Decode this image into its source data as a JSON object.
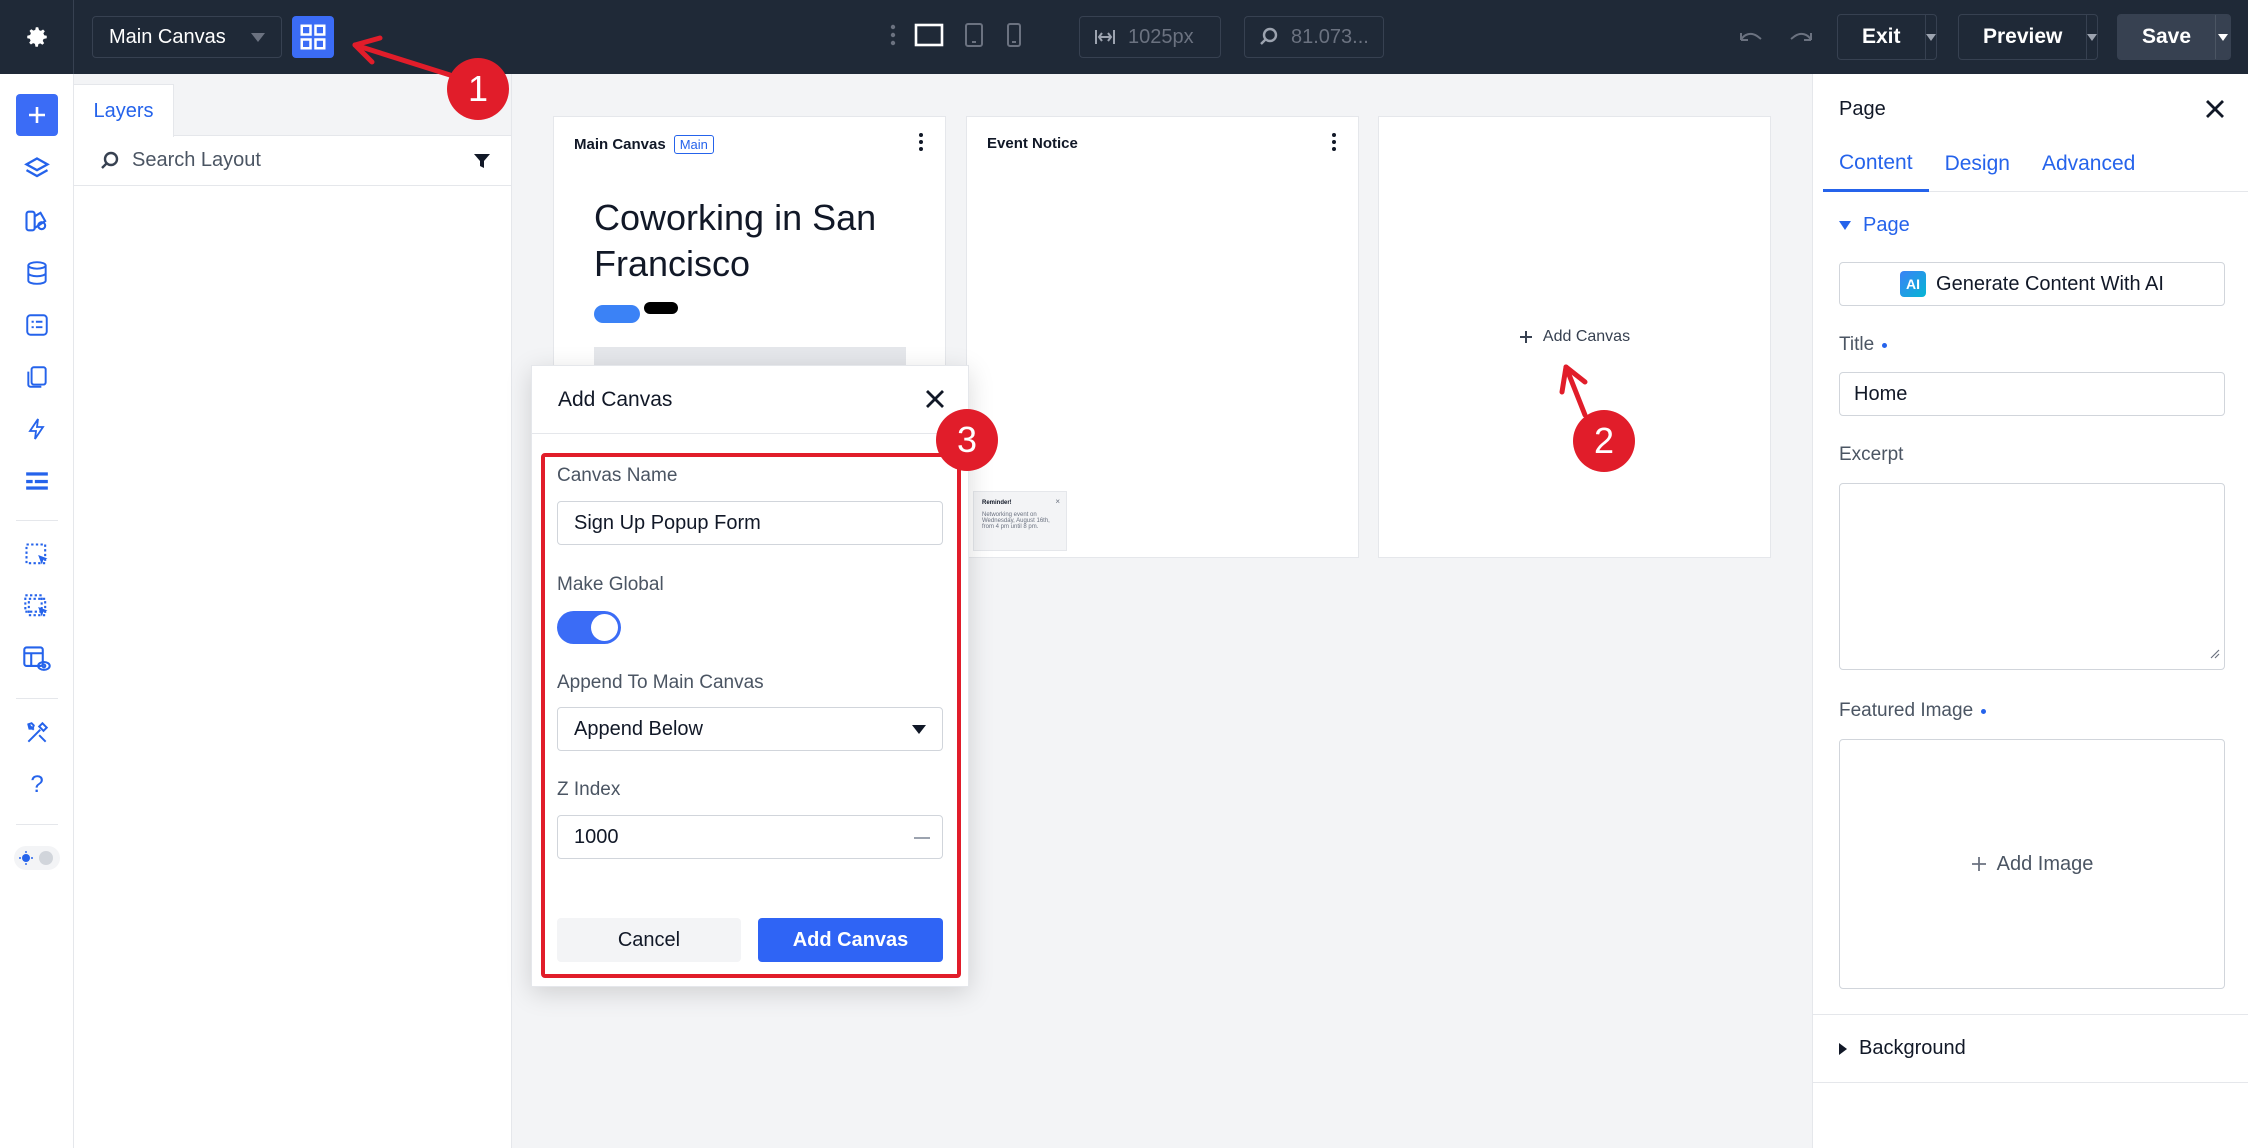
{
  "topbar": {
    "canvas_select": "Main Canvas",
    "width_value": "1025px",
    "zoom_value": "81.073...",
    "exit_label": "Exit",
    "preview_label": "Preview",
    "save_label": "Save"
  },
  "layers": {
    "tab_label": "Layers",
    "search_placeholder": "Search Layout"
  },
  "workspace": {
    "main_card": {
      "title": "Main Canvas",
      "badge": "Main",
      "hero": "Coworking in San Francisco"
    },
    "event_card": {
      "title": "Event Notice"
    },
    "add_card": {
      "label": "Add Canvas"
    },
    "mini_notice": {
      "title": "Reminder!",
      "body": "Networking event on Wednesday, August 16th, from 4 pm until 8 pm."
    }
  },
  "modal": {
    "title": "Add Canvas",
    "canvas_name_label": "Canvas Name",
    "canvas_name_value": "Sign Up Popup Form",
    "make_global_label": "Make Global",
    "make_global_on": true,
    "append_label": "Append To Main Canvas",
    "append_value": "Append Below",
    "zindex_label": "Z Index",
    "zindex_value": "1000",
    "cancel_label": "Cancel",
    "submit_label": "Add Canvas"
  },
  "right_panel": {
    "title": "Page",
    "tabs": [
      {
        "label": "Content",
        "active": true
      },
      {
        "label": "Design",
        "active": false
      },
      {
        "label": "Advanced",
        "active": false
      }
    ],
    "section_page": "Page",
    "ai_button": "Generate Content With AI",
    "ai_badge": "AI",
    "title_label": "Title",
    "title_value": "Home",
    "excerpt_label": "Excerpt",
    "featured_image_label": "Featured Image",
    "add_image_label": "Add Image",
    "section_background": "Background"
  },
  "annotations": [
    "1",
    "2",
    "3"
  ],
  "colors": {
    "accent": "#2f64f5",
    "topbar": "#1f2937",
    "callout": "#e11d2a"
  }
}
